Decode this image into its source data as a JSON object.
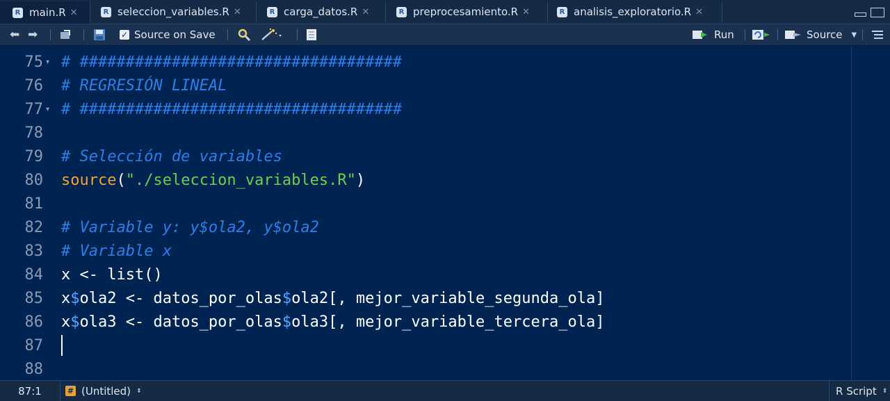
{
  "tabs": [
    {
      "label": "main.R",
      "active": true
    },
    {
      "label": "seleccion_variables.R",
      "active": false
    },
    {
      "label": "carga_datos.R",
      "active": false
    },
    {
      "label": "preprocesamiento.R",
      "active": false
    },
    {
      "label": "analisis_exploratorio.R",
      "active": false
    }
  ],
  "toolbar": {
    "source_on_save_label": "Source on Save",
    "source_on_save_checked": true,
    "run_label": "Run",
    "source_label": "Source"
  },
  "editor": {
    "line_numbers": [
      "75",
      "76",
      "77",
      "78",
      "79",
      "80",
      "81",
      "82",
      "83",
      "84",
      "85",
      "86",
      "87",
      "88"
    ],
    "code": {
      "l75": "# ###################################",
      "l76": "# REGRESIÓN LINEAL",
      "l77": "# ###################################",
      "l79": "# Selección de variables",
      "l80_fn": "source",
      "l80_open": "(",
      "l80_str": "\"./seleccion_variables.R\"",
      "l80_close": ")",
      "l82": "# Variable y: y$ola2, y$ola2",
      "l83": "# Variable x",
      "l84": "x <- list()",
      "l85_a": "x",
      "l85_b": "ola2 <- datos_por_olas",
      "l85_c": "ola2[, mejor_variable_segunda_ola]",
      "l86_a": "x",
      "l86_b": "ola3 <- datos_por_olas",
      "l86_c": "ola3[, mejor_variable_tercera_ola]",
      "dollar": "$"
    }
  },
  "statusbar": {
    "position": "87:1",
    "scope": "(Untitled)",
    "file_type": "R Script"
  },
  "colors": {
    "editor_bg": "#002451",
    "comment": "#2f7ee8",
    "function": "#f2a331",
    "string": "#6ecf4a"
  }
}
